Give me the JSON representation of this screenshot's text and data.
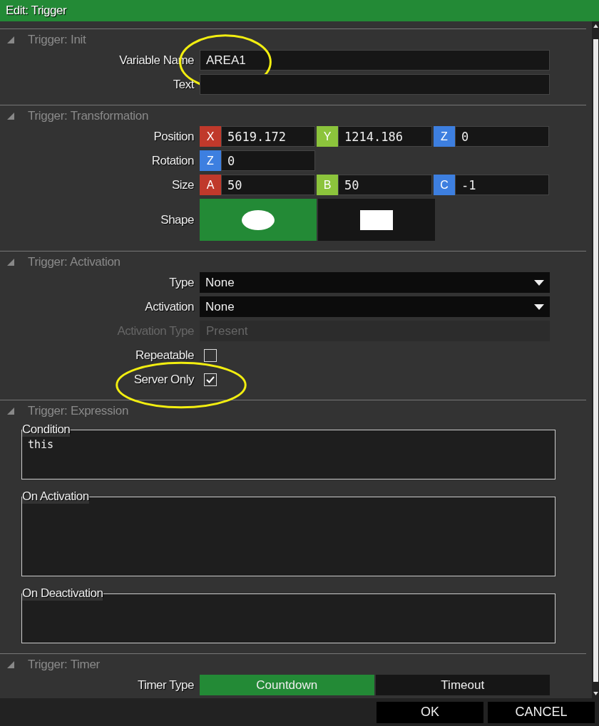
{
  "window": {
    "title": "Edit: Trigger"
  },
  "sections": [
    {
      "title": "Trigger: Init",
      "expanded": true,
      "rows": [
        {
          "kind": "text",
          "label": "Variable Name",
          "value": "AREA1",
          "annotated": true
        },
        {
          "kind": "text",
          "label": "Text",
          "annotated": false
        }
      ]
    },
    {
      "title": "Trigger: Transformation",
      "expanded": true,
      "rows": [
        {
          "kind": "vector",
          "label": "Position",
          "components": [
            {
              "axis": "X",
              "color": "#c0392b",
              "value": "5619.172"
            },
            {
              "axis": "Y",
              "color": "#8cc43c",
              "value": "1214.186"
            },
            {
              "axis": "Z",
              "color": "#3d7fe0",
              "value": "0"
            }
          ]
        },
        {
          "kind": "vector",
          "label": "Rotation",
          "components": [
            {
              "axis": "Z",
              "color": "#3d7fe0",
              "value": "0"
            }
          ]
        },
        {
          "kind": "vector",
          "label": "Size",
          "components": [
            {
              "axis": "A",
              "color": "#c0392b",
              "value": "50"
            },
            {
              "axis": "B",
              "color": "#8cc43c",
              "value": "50"
            },
            {
              "axis": "C",
              "color": "#3d7fe0",
              "value": "-1"
            }
          ]
        },
        {
          "kind": "shape",
          "label": "Shape",
          "options": [
            {
              "kind": "ellipse",
              "selected": true
            },
            {
              "kind": "rectangle",
              "selected": false
            }
          ]
        }
      ]
    },
    {
      "title": "Trigger: Activation",
      "expanded": true,
      "rows": [
        {
          "kind": "select",
          "label": "Type",
          "value": "None"
        },
        {
          "kind": "select",
          "label": "Activation",
          "value": "None"
        },
        {
          "kind": "text",
          "label": "Activation Type",
          "value": "Present",
          "disabled": true
        },
        {
          "kind": "checkbox",
          "label": "Repeatable",
          "checked": false,
          "annotated": false
        },
        {
          "kind": "checkbox",
          "label": "Server Only",
          "checked": true,
          "annotated": true
        }
      ]
    },
    {
      "title": "Trigger: Expression",
      "expanded": true,
      "rows": [
        {
          "kind": "code",
          "label": "Condition",
          "value": "this"
        },
        {
          "kind": "code",
          "label": "On Activation"
        },
        {
          "kind": "code",
          "label": "On Deactivation"
        }
      ]
    },
    {
      "title": "Trigger: Timer",
      "expanded": true,
      "rows": [
        {
          "kind": "toggle",
          "label": "Timer Type",
          "options": [
            {
              "label": "Countdown",
              "selected": true
            },
            {
              "label": "Timeout",
              "selected": false
            }
          ]
        }
      ]
    }
  ],
  "buttons": [
    {
      "label": "OK"
    },
    {
      "label": "CANCEL"
    }
  ]
}
